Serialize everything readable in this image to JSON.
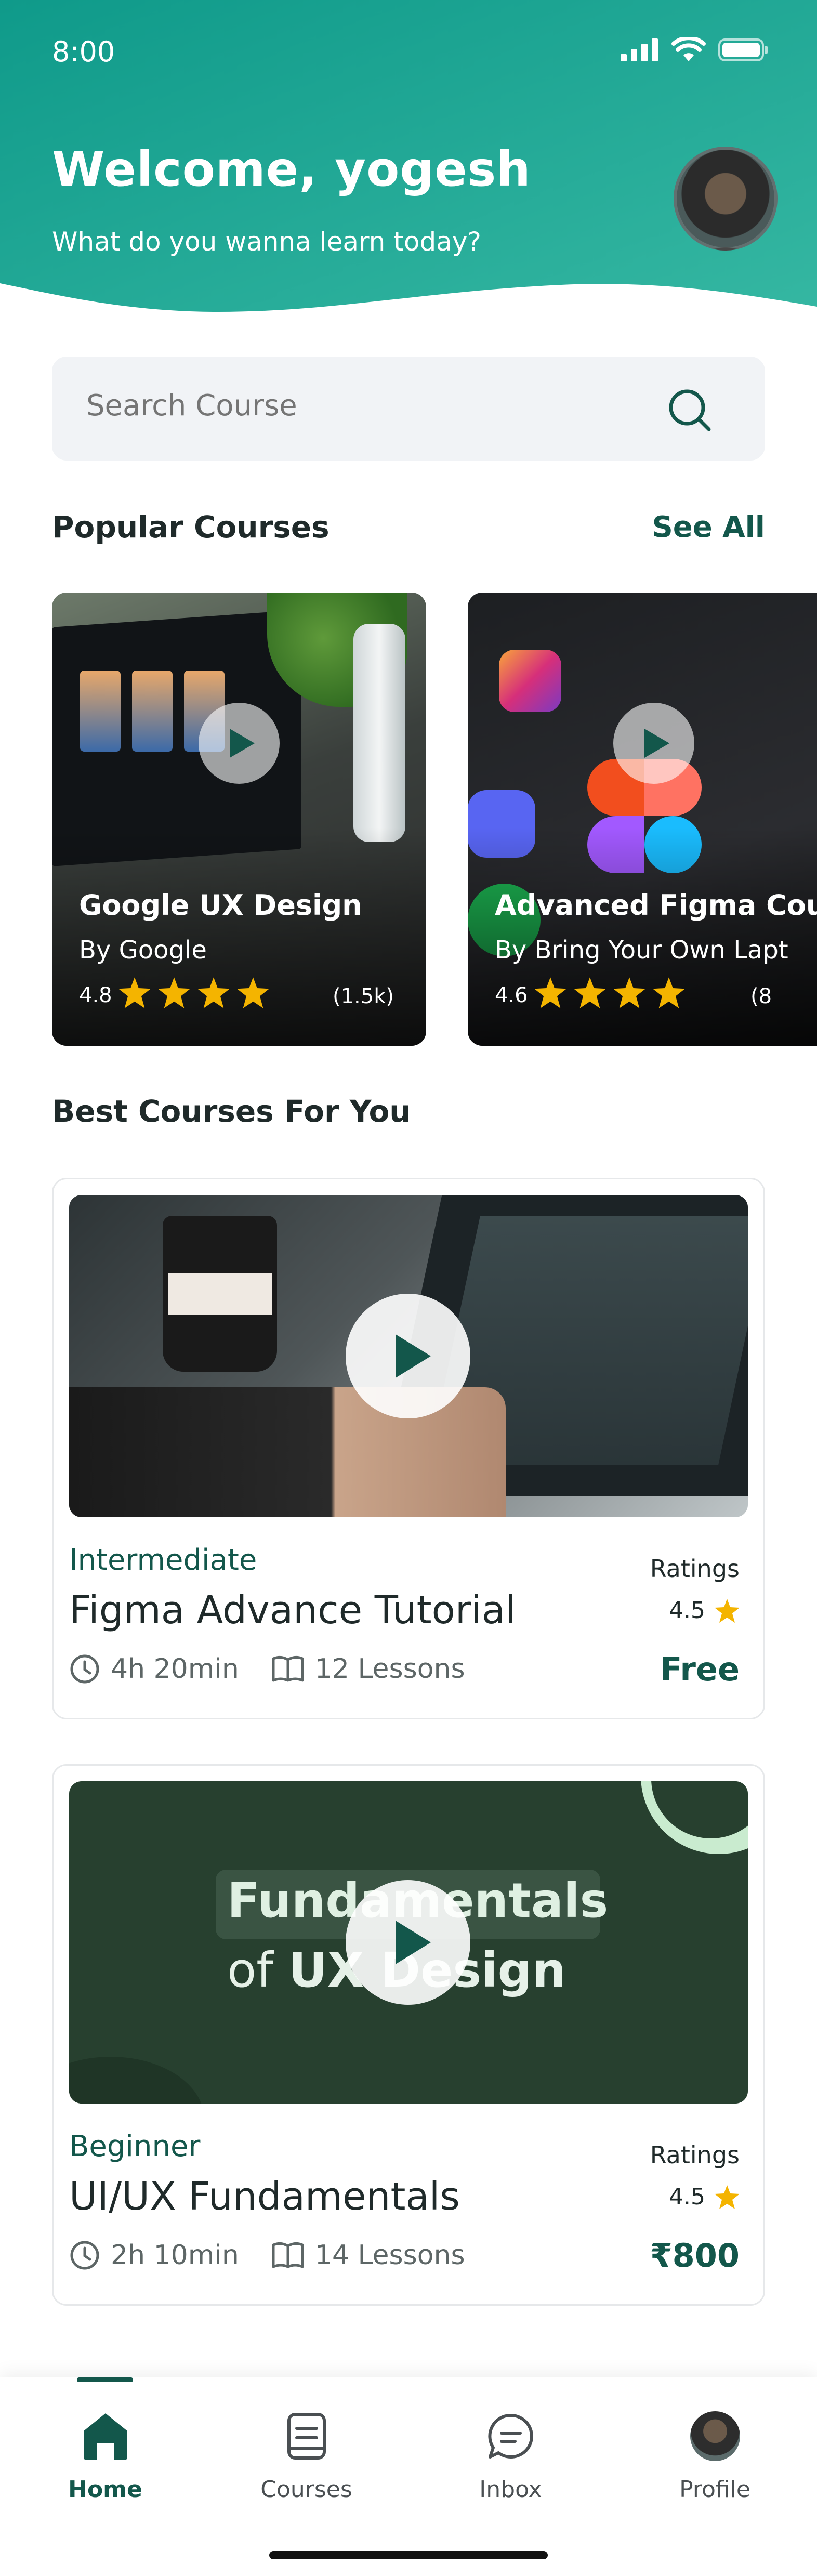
{
  "status_bar": {
    "time": "8:00"
  },
  "header": {
    "welcome": "Welcome, yogesh",
    "subtitle": "What do you wanna learn today?",
    "avatar_icon": "user-avatar",
    "gradient": [
      "#0f9f8e",
      "#2bb39f"
    ]
  },
  "search": {
    "placeholder": "Search Course",
    "icon": "search-icon"
  },
  "popular": {
    "title": "Popular Courses",
    "see_all": "See All",
    "items": [
      {
        "title": "Google UX Design",
        "author": "By Google",
        "rating": "4.8",
        "stars": 4,
        "count": "(1.5k)"
      },
      {
        "title": "Advanced Figma Cou",
        "author": "By Bring Your Own Lapt",
        "rating": "4.6",
        "stars": 4,
        "count": "(8"
      }
    ]
  },
  "best": {
    "title": "Best Courses For You",
    "ratings_label": "Ratings",
    "items": [
      {
        "level": "Intermediate",
        "title": "Figma Advance Tutorial",
        "duration": "4h 20min",
        "lessons": "12 Lessons",
        "rating": "4.5",
        "price": "Free"
      },
      {
        "level": "Beginner",
        "title": "UI/UX Fundamentals",
        "duration": "2h 10min",
        "lessons": "14 Lessons",
        "rating": "4.5",
        "price": "₹800",
        "thumb_text": {
          "line1": "Fundamentals",
          "line2_pre": "of ",
          "line2_bold": "UX Design"
        }
      }
    ]
  },
  "nav": {
    "items": [
      {
        "label": "Home",
        "icon": "home-icon",
        "active": true
      },
      {
        "label": "Courses",
        "icon": "book-icon",
        "active": false
      },
      {
        "label": "Inbox",
        "icon": "chat-icon",
        "active": false
      },
      {
        "label": "Profile",
        "icon": "avatar",
        "active": false
      }
    ]
  },
  "colors": {
    "accent": "#13574b",
    "star": "#f4b400",
    "teal": "#17a391"
  }
}
